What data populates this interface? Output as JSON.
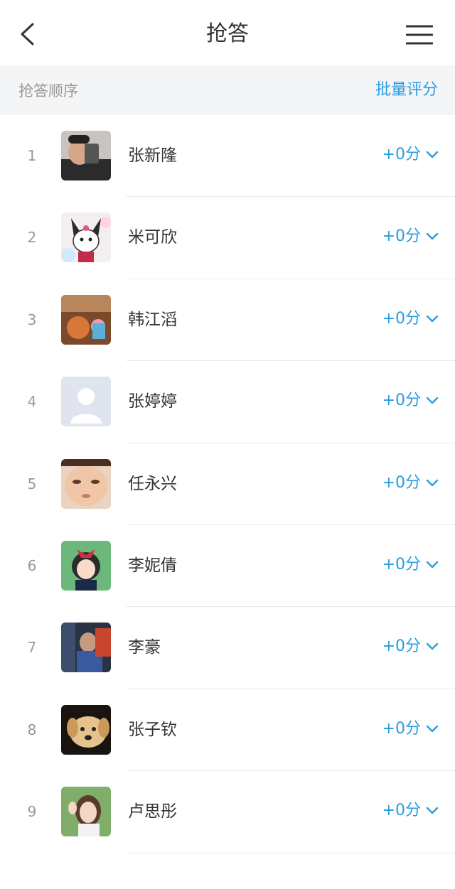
{
  "header": {
    "title": "抢答",
    "back_icon": "chevron-left-icon",
    "menu_icon": "hamburger-menu-icon"
  },
  "subbar": {
    "label": "抢答顺序",
    "action": "批量评分"
  },
  "accent_color": "#2a9be0",
  "students": [
    {
      "rank": "1",
      "name": "张新隆",
      "score": "+0分",
      "avatar": "photo-selfie"
    },
    {
      "rank": "2",
      "name": "米可欣",
      "score": "+0分",
      "avatar": "cartoon-kuromi"
    },
    {
      "rank": "3",
      "name": "韩江滔",
      "score": "+0分",
      "avatar": "photo-toys"
    },
    {
      "rank": "4",
      "name": "张婷婷",
      "score": "+0分",
      "avatar": "default-user"
    },
    {
      "rank": "5",
      "name": "任永兴",
      "score": "+0分",
      "avatar": "photo-baby"
    },
    {
      "rank": "6",
      "name": "李妮倩",
      "score": "+0分",
      "avatar": "cartoon-girl"
    },
    {
      "rank": "7",
      "name": "李豪",
      "score": "+0分",
      "avatar": "photo-person"
    },
    {
      "rank": "8",
      "name": "张子钦",
      "score": "+0分",
      "avatar": "photo-dog"
    },
    {
      "rank": "9",
      "name": "卢思彤",
      "score": "+0分",
      "avatar": "photo-girl"
    }
  ]
}
